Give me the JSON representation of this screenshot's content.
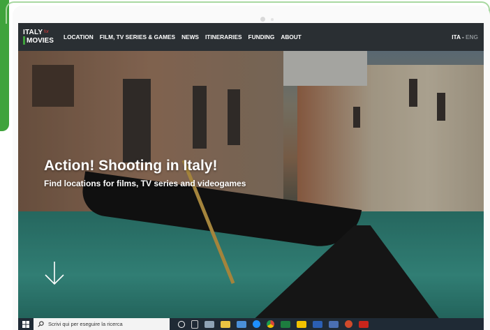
{
  "nav": {
    "logo_top": "ITALY",
    "logo_for": "for",
    "logo_bottom": "MOVIES",
    "items": [
      {
        "label": "LOCATION"
      },
      {
        "label": "FILM, TV SERIES & GAMES"
      },
      {
        "label": "NEWS"
      },
      {
        "label": "ITINERARIES"
      },
      {
        "label": "FUNDING"
      },
      {
        "label": "ABOUT"
      }
    ],
    "lang_active": "ITA",
    "lang_sep": " - ",
    "lang_other": "ENG"
  },
  "hero": {
    "title": "Action! Shooting in Italy!",
    "subtitle": "Find locations for films, TV series and videogames",
    "arrow_icon": "arrow-down-icon"
  },
  "taskbar": {
    "search_placeholder": "Scrivi qui per eseguire la ricerca",
    "icons": [
      "windows-start-icon",
      "search-icon",
      "cortana-icon",
      "task-view-icon",
      "people-icon",
      "file-explorer-icon",
      "store-icon",
      "skype-icon",
      "chrome-icon",
      "excel-icon",
      "sticky-notes-icon",
      "word-icon",
      "outlook-icon",
      "powerpoint-icon",
      "acrobat-icon"
    ],
    "icon_colors": [
      "#ffffff",
      "#3a7bd5",
      "#e8c442",
      "#4a90d9",
      "#1e90ff",
      "#d9453a",
      "#1d7d3f",
      "#f2c200",
      "#2b5fb4",
      "#4a6fb3",
      "#d04a2b",
      "#c8251c"
    ]
  },
  "colors": {
    "nav_bg": "#2a2f33",
    "accent_green": "#3fa33c",
    "accent_red": "#e23a3a"
  }
}
